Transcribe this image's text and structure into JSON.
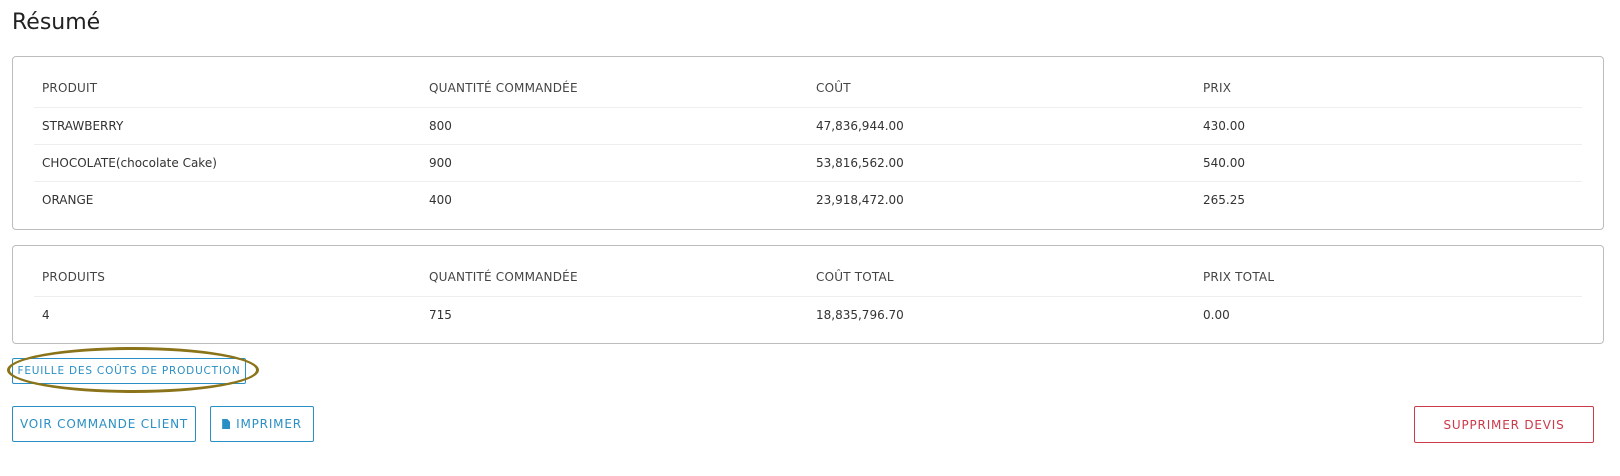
{
  "page": {
    "title": "Résumé"
  },
  "lines_table": {
    "headers": [
      "PRODUIT",
      "QUANTITÉ COMMANDÉE",
      "COÛT",
      "PRIX"
    ],
    "rows": [
      [
        "STRAWBERRY",
        "800",
        "47,836,944.00",
        "430.00"
      ],
      [
        "CHOCOLATE(chocolate Cake)",
        "900",
        "53,816,562.00",
        "540.00"
      ],
      [
        "ORANGE",
        "400",
        "23,918,472.00",
        "265.25"
      ]
    ]
  },
  "totals_table": {
    "headers": [
      "PRODUITS",
      "QUANTITÉ COMMANDÉE",
      "COÛT TOTAL",
      "PRIX TOTAL"
    ],
    "row": [
      "4",
      "715",
      "18,835,796.70",
      "0.00"
    ]
  },
  "actions": {
    "production_sheet_label": "FEUILLE DES COÛTS DE PRODUCTION",
    "view_order_label": "VOIR COMMANDE CLIENT",
    "print_label": "IMPRIMER",
    "delete_label": "SUPPRIMER DEVIS",
    "print_icon": "document-icon"
  },
  "colors": {
    "primary": "#2a8fc4",
    "danger": "#cc3a4a",
    "annotation": "#8a7318"
  }
}
